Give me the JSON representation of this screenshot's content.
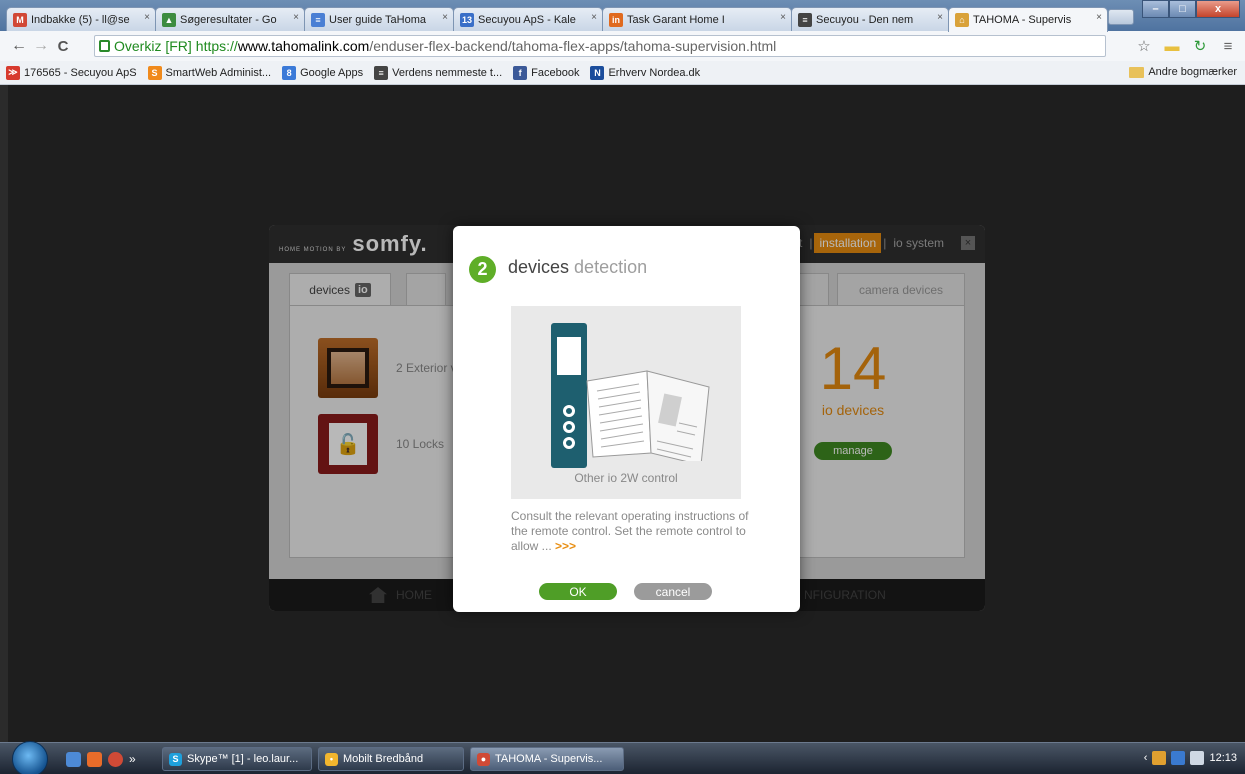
{
  "browser": {
    "tabs": [
      {
        "label": "Indbakke (5) - ll@se",
        "icon": "gmail-icon",
        "icon_glyph": "M",
        "color": "#d14836"
      },
      {
        "label": "Søgeresultater - Go",
        "icon": "drive-icon",
        "icon_glyph": "▲",
        "color": "#3d8c40"
      },
      {
        "label": "User guide TaHoma",
        "icon": "docs-icon",
        "icon_glyph": "≡",
        "color": "#4a7fd4"
      },
      {
        "label": "Secuyou ApS - Kale",
        "icon": "calendar-icon",
        "icon_glyph": "13",
        "color": "#3a6fc8"
      },
      {
        "label": "Task Garant Home I",
        "icon": "task-icon",
        "icon_glyph": "in",
        "color": "#e06a1f"
      },
      {
        "label": "Secuyou - Den nem",
        "icon": "page-icon",
        "icon_glyph": "≡",
        "color": "#444444"
      },
      {
        "label": "TAHOMA - Supervis",
        "icon": "somfy-icon",
        "icon_glyph": "⌂",
        "color": "#d9a23a"
      }
    ],
    "tab_close": "×",
    "window_buttons": {
      "minimize": "–",
      "maximize": "□",
      "close": "x"
    },
    "nav": {
      "back": "←",
      "forward": "→",
      "reload": "C"
    },
    "address": {
      "ev_label": "Overkiz [FR]",
      "scheme": "https://",
      "host": "www.tahomalink.com",
      "path": "/enduser-flex-backend/tahoma-flex-apps/tahoma-supervision.html"
    },
    "toolbar_icons": {
      "star": "☆",
      "extension": "▬",
      "refresh_ext": "↻",
      "menu": "≡"
    },
    "bookmarks": [
      {
        "label": "176565 - Secuyou ApS",
        "icon": "secuyou-icon",
        "color": "#d73a2e",
        "glyph": "≫"
      },
      {
        "label": "SmartWeb Administ...",
        "icon": "smartweb-icon",
        "color": "#f08a1c",
        "glyph": "S"
      },
      {
        "label": "Google Apps",
        "icon": "google-apps-icon",
        "color": "#3b7ad8",
        "glyph": "8"
      },
      {
        "label": "Verdens nemmeste t...",
        "icon": "page-icon",
        "color": "#444444",
        "glyph": "≡"
      },
      {
        "label": "Facebook",
        "icon": "facebook-icon",
        "color": "#3b5998",
        "glyph": "f"
      },
      {
        "label": "Erhverv Nordea.dk",
        "icon": "nordea-icon",
        "color": "#1b4d9c",
        "glyph": "N"
      }
    ],
    "other_bookmarks": "Andre bogmærker"
  },
  "app": {
    "brand_small": "HOME MOTION BY",
    "brand_name": "somfy.",
    "header_menu": {
      "partial": "t",
      "installation": "installation",
      "io_system": "io system",
      "sep": "|",
      "close": "×"
    },
    "tabs": {
      "devices": "devices",
      "io_badge": "io",
      "camera": "camera devices"
    },
    "devices": [
      {
        "label": "2 Exterior v",
        "icon": "shutter-icon"
      },
      {
        "label": "10 Locks",
        "icon": "lock-icon",
        "glyph": "🔓"
      }
    ],
    "count": "14",
    "count_label": "io devices",
    "manage": "manage",
    "footer": {
      "home": "HOME",
      "config": "NFIGURATION"
    }
  },
  "dialog": {
    "step": "2",
    "title_main": "devices",
    "title_soft": "detection",
    "caption": "Other io 2W control",
    "body": "Consult the relevant operating instructions of the remote control. Set the remote control to allow ...",
    "more": ">>>",
    "ok": "OK",
    "cancel": "cancel"
  },
  "taskbar": {
    "more": "»",
    "tasks": [
      {
        "label": "Skype™ [1] - leo.laur...",
        "icon": "skype-icon",
        "color": "#1ea0dc",
        "glyph": "S"
      },
      {
        "label": "Mobilt Bredbånd",
        "icon": "mobile-broadband-icon",
        "color": "#f2b62e",
        "glyph": "•"
      },
      {
        "label": "TAHOMA - Supervis...",
        "icon": "chrome-icon",
        "color": "#d04a36",
        "glyph": "●"
      }
    ],
    "tray_arrow": "‹",
    "clock": "12:13"
  }
}
